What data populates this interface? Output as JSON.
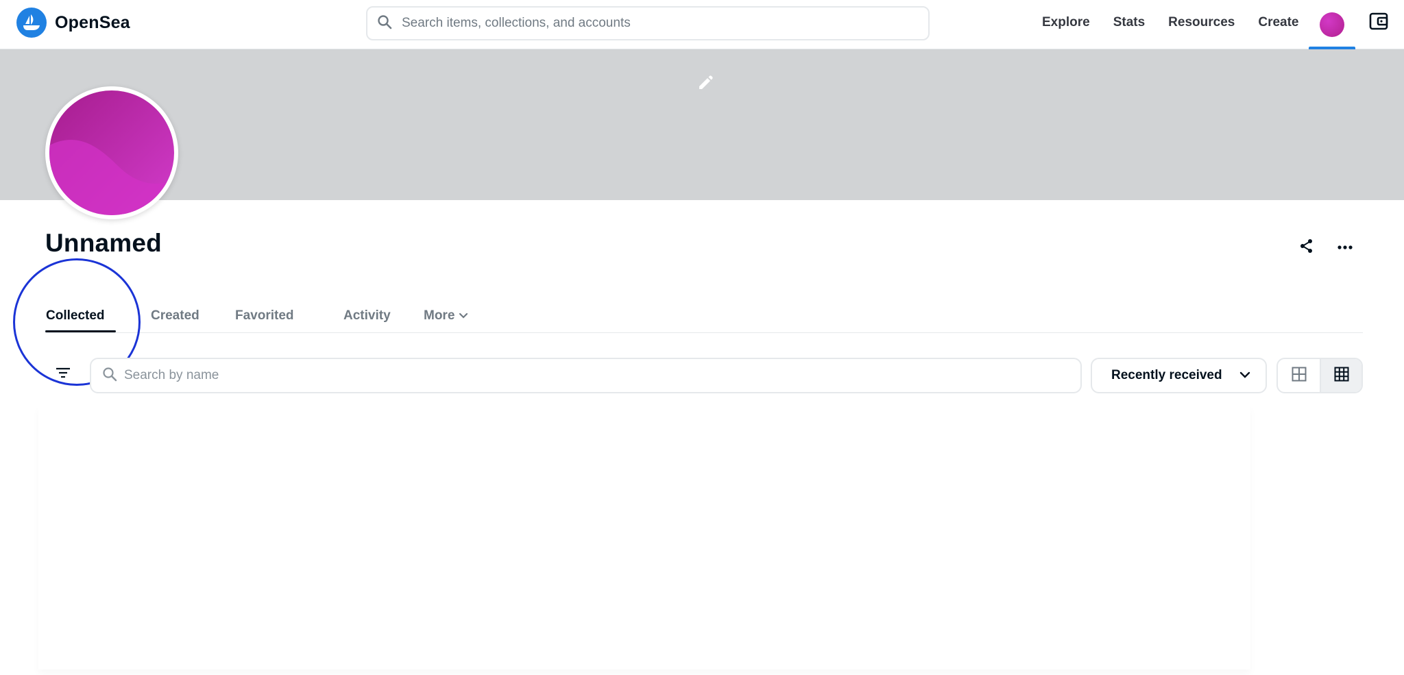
{
  "header": {
    "brand": "OpenSea",
    "search_placeholder": "Search items, collections, and accounts",
    "nav": [
      "Explore",
      "Stats",
      "Resources",
      "Create"
    ],
    "accent_color": "#2081e2"
  },
  "profile": {
    "name": "Unnamed",
    "banner_color": "#d1d3d5",
    "avatar_colors": [
      "#b2208f",
      "#d63fd0"
    ]
  },
  "tabs": {
    "items": [
      "Collected",
      "Created",
      "Favorited",
      "Activity"
    ],
    "more_label": "More",
    "active": "Collected"
  },
  "toolbar": {
    "search_placeholder": "Search by name",
    "sort_label": "Recently received"
  }
}
